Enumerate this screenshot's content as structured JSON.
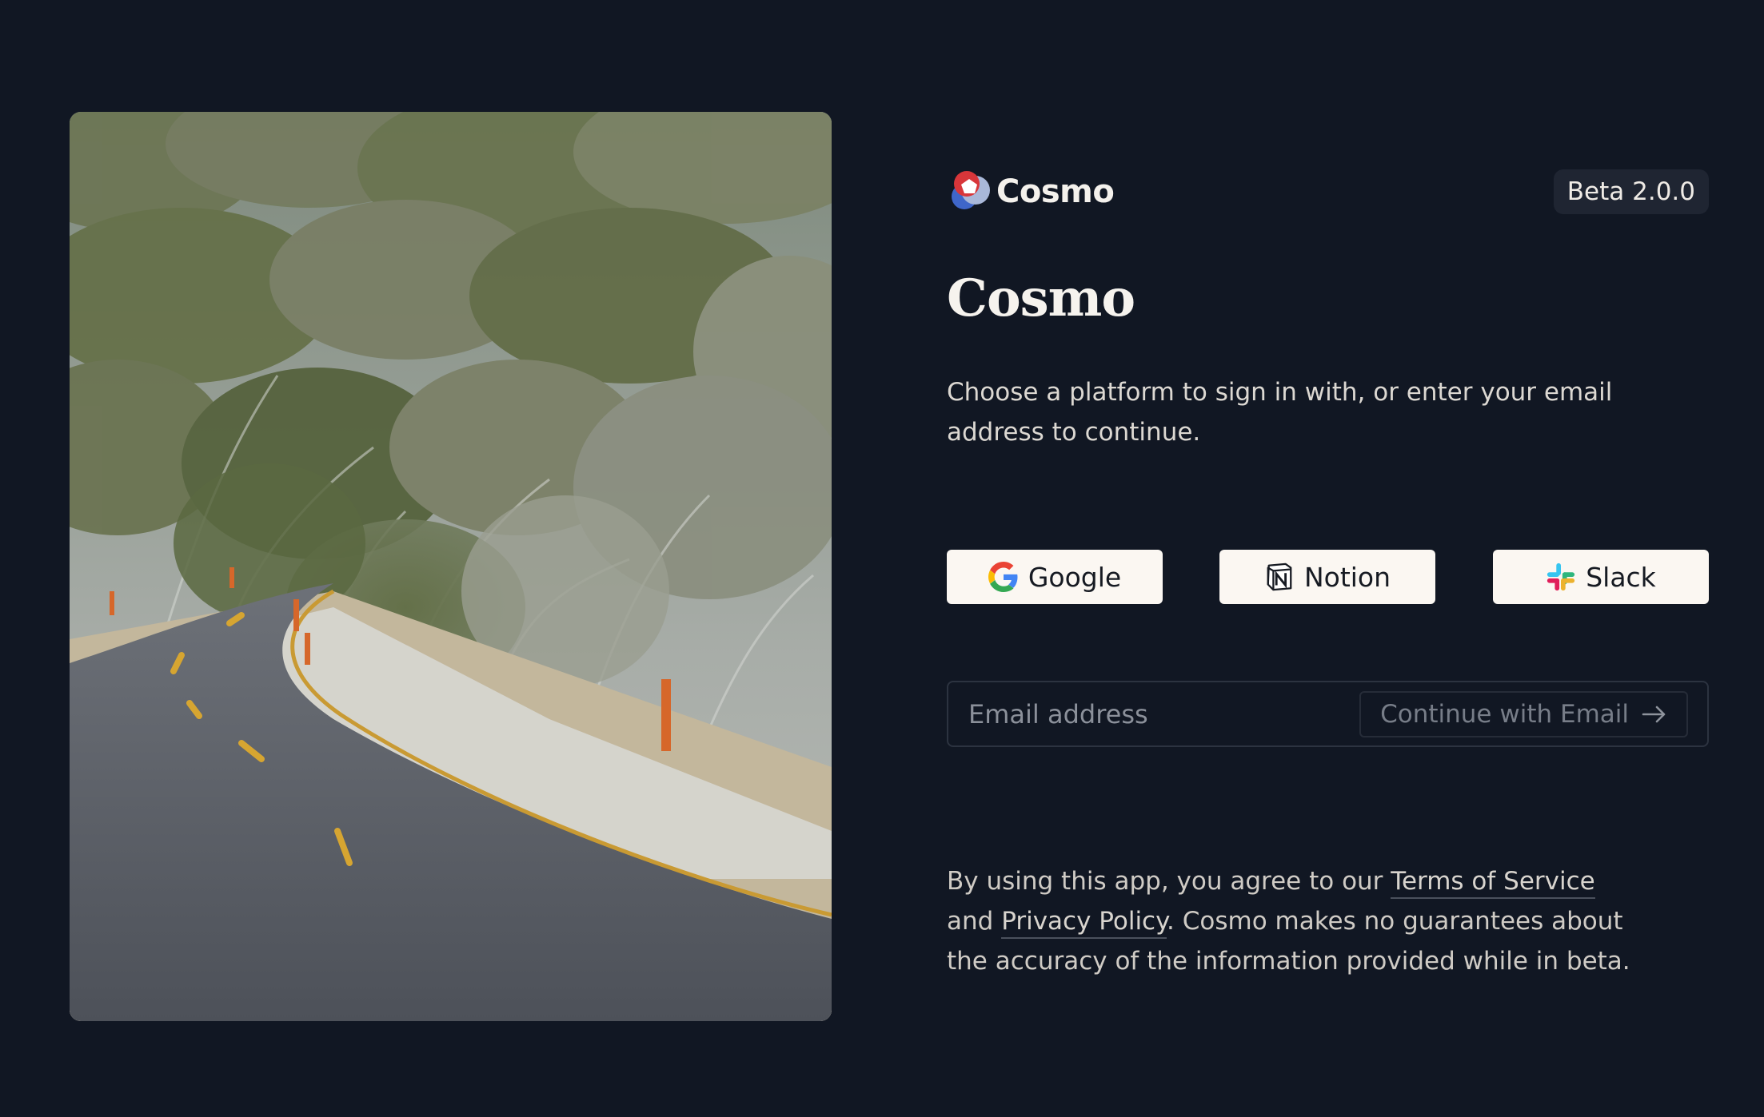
{
  "brand": {
    "name": "Cosmo",
    "logo_icon": "cosmo-logo-icon"
  },
  "version_badge": "Beta 2.0.0",
  "title": "Cosmo",
  "subtitle": "Choose a platform to sign in with, or enter your email address to continue.",
  "oauth": [
    {
      "label": "Google",
      "icon": "google-icon"
    },
    {
      "label": "Notion",
      "icon": "notion-icon"
    },
    {
      "label": "Slack",
      "icon": "slack-icon"
    }
  ],
  "email": {
    "placeholder": "Email address",
    "value": "",
    "continue_label": "Continue with Email"
  },
  "legal": {
    "prefix": "By using this app, you agree to our ",
    "terms_link": "Terms of Service",
    "middle": " and ",
    "privacy_link": "Privacy Policy",
    "suffix": ". Cosmo makes no guarantees about the accuracy of the information provided while in beta."
  },
  "hero_image": {
    "subject": "winding snowy mountain road lined with snow-dusted trees"
  },
  "colors": {
    "background": "#111723",
    "button_bg": "#fbf7f2",
    "badge_bg": "#1f2532",
    "google_blue": "#4285F4",
    "google_red": "#EA4335",
    "google_yellow": "#FBBC05",
    "google_green": "#34A853",
    "slack_cyan": "#36C5F0",
    "slack_green": "#2EB67D",
    "slack_red": "#E01E5A",
    "slack_yellow": "#ECB22E"
  }
}
